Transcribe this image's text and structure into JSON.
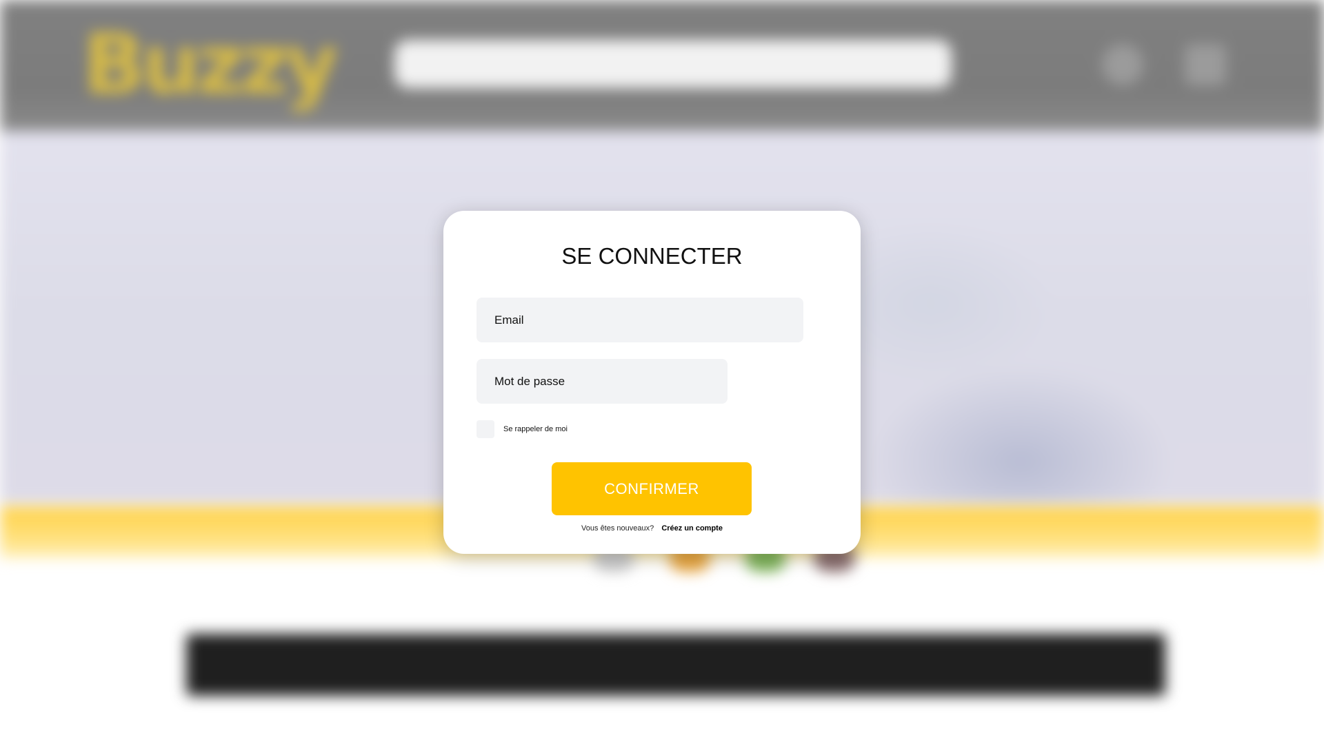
{
  "background": {
    "logo_text": "Buzzy",
    "accent_color": "#ffc300"
  },
  "login": {
    "title": "SE CONNECTER",
    "email_placeholder": "Email",
    "password_placeholder": "Mot de passe",
    "remember_label": "Se rappeler de moi",
    "remember_checked": false,
    "confirm_label": "CONFIRMER",
    "signup_prompt": "Vous êtes nouveaux?",
    "signup_link": "Créez un compte"
  }
}
